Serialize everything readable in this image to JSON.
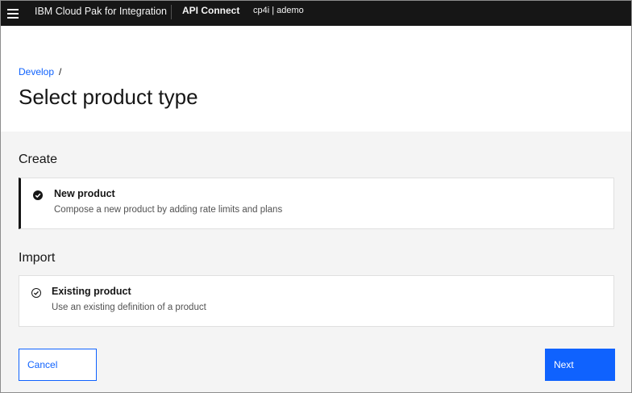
{
  "header": {
    "brand": "IBM Cloud Pak for Integration",
    "product": "API Connect",
    "context": "cp4i | ademo",
    "menu_icon": "hamburger-menu-icon"
  },
  "breadcrumb": {
    "link": "Develop",
    "separator": "/"
  },
  "page_title": "Select product type",
  "sections": {
    "create": {
      "title": "Create",
      "tile": {
        "title": "New product",
        "description": "Compose a new product by adding rate limits and plans",
        "icon": "checkmark-filled-icon",
        "selected": true
      }
    },
    "import": {
      "title": "Import",
      "tile": {
        "title": "Existing product",
        "description": "Use an existing definition of a product",
        "icon": "checkmark-outline-icon",
        "selected": false
      }
    }
  },
  "actions": {
    "cancel_label": "Cancel",
    "next_label": "Next"
  },
  "colors": {
    "header_bg": "#161616",
    "accent": "#0f62fe",
    "content_bg": "#f4f4f4"
  }
}
